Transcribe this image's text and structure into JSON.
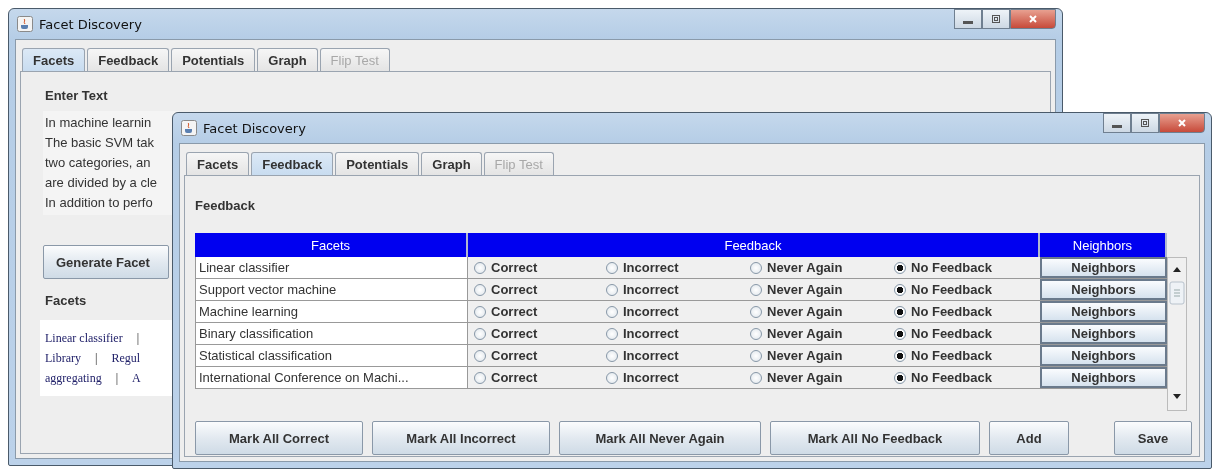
{
  "back_window": {
    "title": "Facet Discovery",
    "tabs": [
      {
        "label": "Facets",
        "selected": true,
        "disabled": false
      },
      {
        "label": "Feedback",
        "selected": false,
        "disabled": false
      },
      {
        "label": "Potentials",
        "selected": false,
        "disabled": false
      },
      {
        "label": "Graph",
        "selected": false,
        "disabled": false
      },
      {
        "label": "Flip Test",
        "selected": false,
        "disabled": true
      }
    ],
    "enter_text_label": "Enter Text",
    "text_lines": [
      "In machine learnin",
      "The basic SVM tak",
      "two categories, an",
      "are divided by a cle",
      "In addition to perfo"
    ],
    "generate_button": "Generate Facet",
    "facets_label": "Facets",
    "facet_links": [
      [
        "Linear classifier",
        "|"
      ],
      [
        "Library",
        "|",
        "Regul"
      ],
      [
        "aggregating",
        "|",
        "A"
      ]
    ]
  },
  "front_window": {
    "title": "Facet Discovery",
    "tabs": [
      {
        "label": "Facets",
        "selected": false,
        "disabled": false
      },
      {
        "label": "Feedback",
        "selected": true,
        "disabled": false
      },
      {
        "label": "Potentials",
        "selected": false,
        "disabled": false
      },
      {
        "label": "Graph",
        "selected": false,
        "disabled": false
      },
      {
        "label": "Flip Test",
        "selected": false,
        "disabled": true
      }
    ],
    "section_label": "Feedback",
    "table": {
      "columns": [
        "Facets",
        "Feedback",
        "Neighbors"
      ],
      "rows": [
        {
          "facet": "Linear classifier",
          "options": [
            {
              "label": "Correct",
              "selected": false
            },
            {
              "label": "Incorrect",
              "selected": false
            },
            {
              "label": "Never Again",
              "selected": false
            },
            {
              "label": "No Feedback",
              "selected": true
            }
          ],
          "neighbors": "Neighbors"
        },
        {
          "facet": "Support vector machine",
          "options": [
            {
              "label": "Correct",
              "selected": false
            },
            {
              "label": "Incorrect",
              "selected": false
            },
            {
              "label": "Never Again",
              "selected": false
            },
            {
              "label": "No Feedback",
              "selected": true
            }
          ],
          "neighbors": "Neighbors"
        },
        {
          "facet": "Machine learning",
          "options": [
            {
              "label": "Correct",
              "selected": false
            },
            {
              "label": "Incorrect",
              "selected": false
            },
            {
              "label": "Never Again",
              "selected": false
            },
            {
              "label": "No Feedback",
              "selected": true
            }
          ],
          "neighbors": "Neighbors"
        },
        {
          "facet": "Binary classification",
          "options": [
            {
              "label": "Correct",
              "selected": false
            },
            {
              "label": "Incorrect",
              "selected": false
            },
            {
              "label": "Never Again",
              "selected": false
            },
            {
              "label": "No Feedback",
              "selected": true
            }
          ],
          "neighbors": "Neighbors"
        },
        {
          "facet": "Statistical classification",
          "options": [
            {
              "label": "Correct",
              "selected": false
            },
            {
              "label": "Incorrect",
              "selected": false
            },
            {
              "label": "Never Again",
              "selected": false
            },
            {
              "label": "No Feedback",
              "selected": true
            }
          ],
          "neighbors": "Neighbors"
        },
        {
          "facet": "International Conference on Machi...",
          "options": [
            {
              "label": "Correct",
              "selected": false
            },
            {
              "label": "Incorrect",
              "selected": false
            },
            {
              "label": "Never Again",
              "selected": false
            },
            {
              "label": "No Feedback",
              "selected": true
            }
          ],
          "neighbors": "Neighbors"
        }
      ]
    },
    "buttons": [
      "Mark All Correct",
      "Mark All Incorrect",
      "Mark All Never Again",
      "Mark All No Feedback",
      "Add",
      "Save"
    ]
  }
}
